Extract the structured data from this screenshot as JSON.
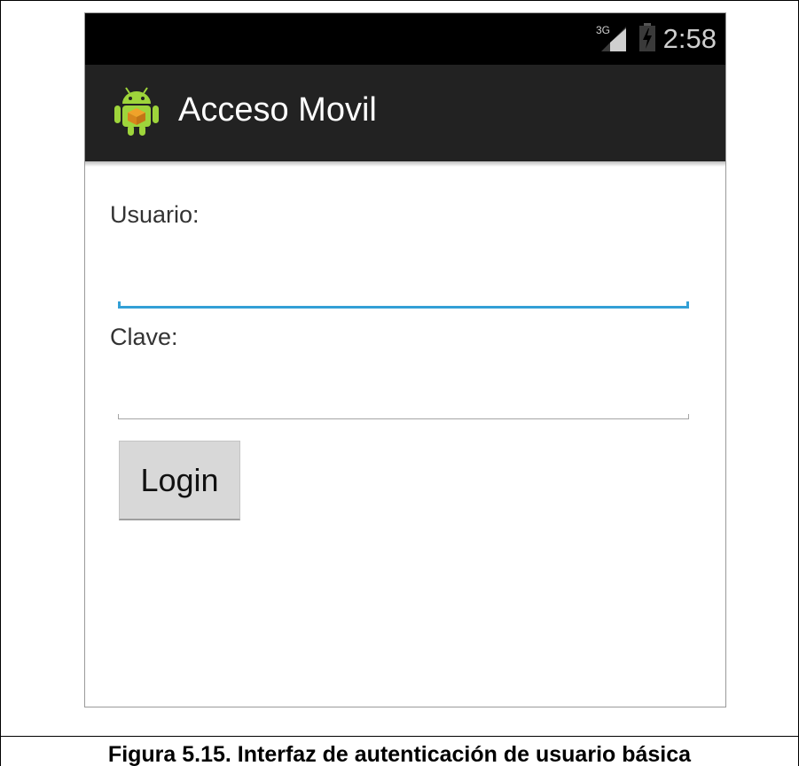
{
  "status_bar": {
    "network": "3G",
    "time": "2:58"
  },
  "action_bar": {
    "title": "Acceso Movil",
    "app_icon": "android-app-icon"
  },
  "form": {
    "user_label": "Usuario:",
    "user_value": "",
    "pass_label": "Clave:",
    "pass_value": "",
    "login_label": "Login"
  },
  "caption": "Figura 5.15. Interfaz de autenticación de usuario básica",
  "colors": {
    "status_bar": "#000000",
    "action_bar": "#222222",
    "field_focus": "#33a0d6",
    "button": "#d8d8d8"
  }
}
